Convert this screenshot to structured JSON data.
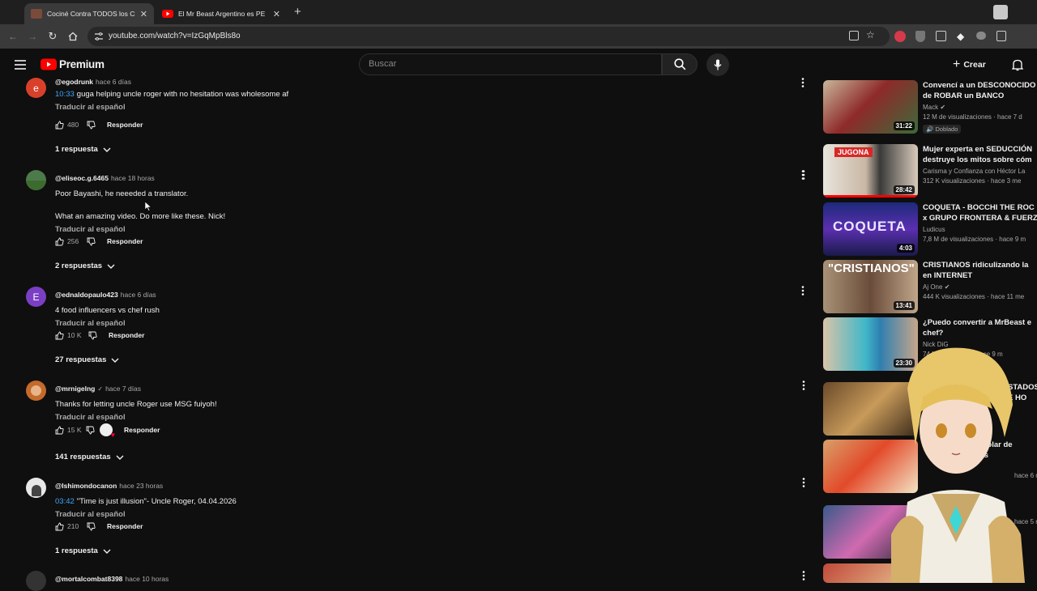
{
  "browser": {
    "tabs": [
      {
        "title": "Cociné Contra TODOS los Crea",
        "active": true
      },
      {
        "title": "El Mr Beast Argentino es PE",
        "active": false
      }
    ],
    "url": "youtube.com/watch?v=IzGqMpBls8o"
  },
  "youtube": {
    "logo_text": "Premium",
    "search_placeholder": "Buscar",
    "create_label": "Crear"
  },
  "comments": [
    {
      "handle": "@egodrunk",
      "time": "hace 6 días",
      "timestamp": "10:33",
      "text": "guga helping uncle roger with no hesitation was wholesome af",
      "translate": "Traducir al español",
      "likes": "480",
      "reply": "Responder",
      "replies": "1 respuesta"
    },
    {
      "handle": "@eliseoc.g.6465",
      "time": "hace 18 horas",
      "text_line1": "Poor Bayashi, he neeeded a translator.",
      "text_line2": "What an amazing video. Do more like these. Nick!",
      "translate": "Traducir al español",
      "likes": "256",
      "reply": "Responder",
      "replies": "2 respuestas"
    },
    {
      "handle": "@ednaldopaulo423",
      "time": "hace 6 días",
      "avatar_letter": "E",
      "text": "4 food influencers vs chef rush",
      "translate": "Traducir al español",
      "likes": "10 K",
      "reply": "Responder",
      "replies": "27 respuestas"
    },
    {
      "handle": "@mrnigelng",
      "time": "hace 7 días",
      "text": "Thanks for letting uncle Roger use MSG fuiyoh!",
      "translate": "Traducir al español",
      "likes": "15 K",
      "reply": "Responder",
      "replies": "141 respuestas"
    },
    {
      "handle": "@Ishimondocanon",
      "time": "hace 23 horas",
      "timestamp": "03:42",
      "text": "\"Time is just illusion\"- Uncle Roger, 04.04.2026",
      "translate": "Traducir al español",
      "likes": "210",
      "reply": "Responder",
      "replies": "1 respuesta"
    },
    {
      "handle": "@mortalcombat8398",
      "time": "hace 10 horas"
    }
  ],
  "sidebar": [
    {
      "title1": "Convencí a un DESCONOCIDO",
      "title2": "de ROBAR un BANCO",
      "channel": "Mack",
      "stats": "12 M de visualizaciones · hace 7 d",
      "badge": "Doblado",
      "duration": "31:22"
    },
    {
      "title1": "Mujer experta en SEDUCCIÓN",
      "title2": "destruye los mitos sobre cóm",
      "channel": "Carisma y Confianza con Héctor La",
      "stats": "312 K visualizaciones · hace 3 me",
      "duration": "28:42"
    },
    {
      "title1": "COQUETA - BOCCHI THE ROC",
      "title2": "x GRUPO FRONTERA & FUERZ",
      "channel": "Ludicus",
      "stats": "7,8 M de visualizaciones · hace 9 m",
      "duration": "4:03"
    },
    {
      "title1": "CRISTIANOS ridiculizando la",
      "title2": "en INTERNET",
      "channel": "Aj One",
      "stats": "444 K visualizaciones · hace 11 me",
      "duration": "13:41"
    },
    {
      "title1": "¿Puedo convertir a MrBeast e",
      "title2": "chef?",
      "channel": "Nick DiG",
      "stats": "74 M",
      "stats2": "hace 9 m",
      "duration": "23:30"
    },
    {
      "title1": "STADOS",
      "title2": "E HO"
    },
    {
      "title1": "D Escolar de",
      "title2": "ses",
      "stats": "hace 6 m"
    },
    {
      "title1": "",
      "stats": "hace 5 me"
    }
  ],
  "colors": {
    "bg": "#0f0f0f",
    "link": "#3ea6ff",
    "ytred": "#ff0000"
  }
}
